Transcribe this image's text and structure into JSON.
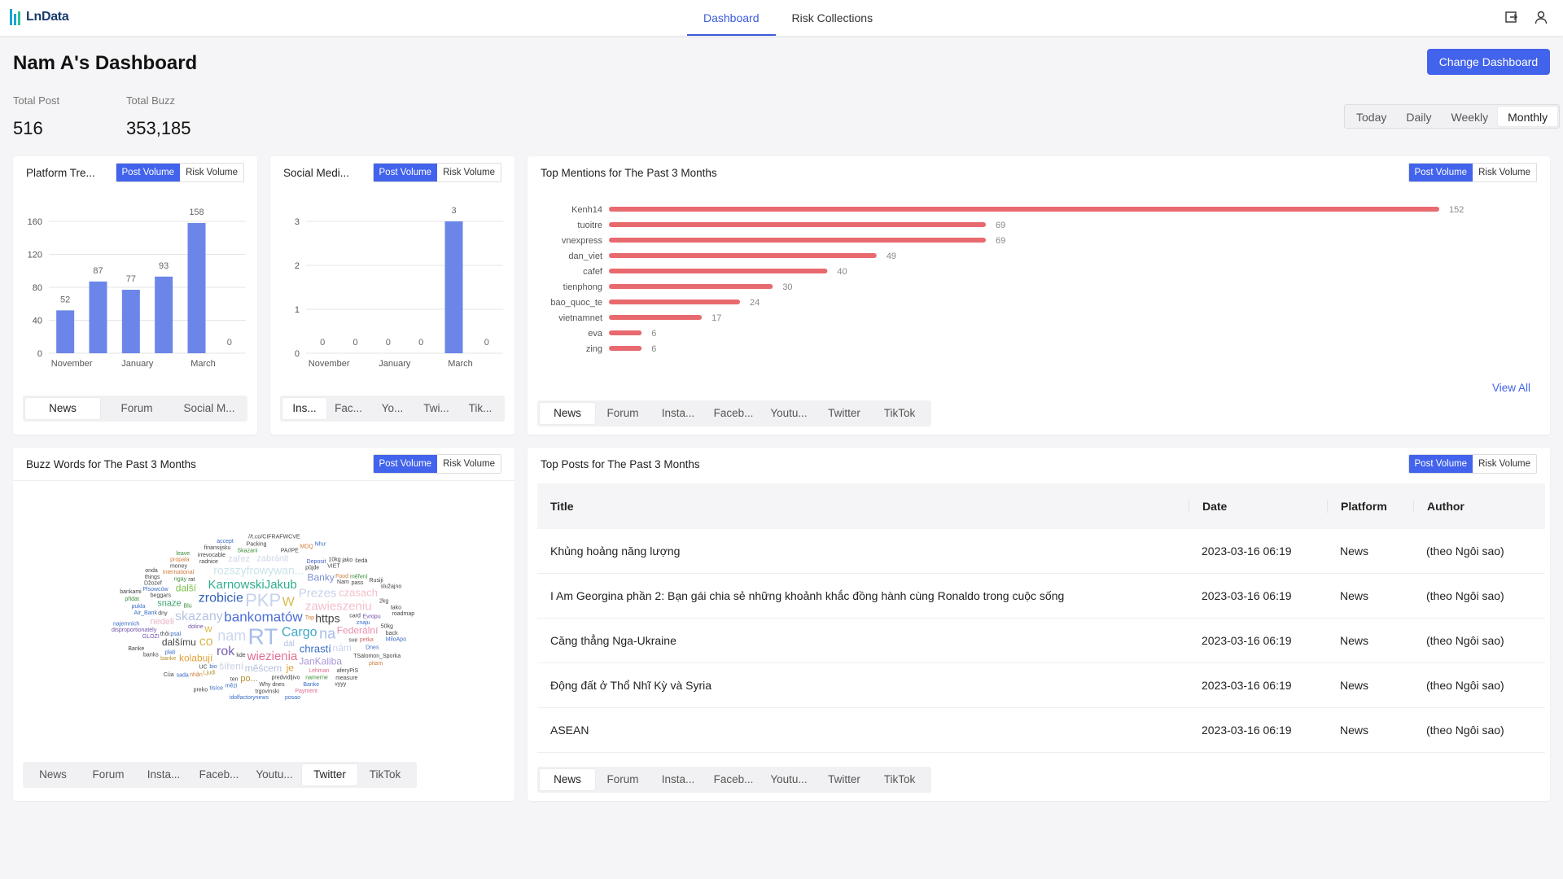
{
  "app": {
    "logo_text": "LnData"
  },
  "nav": {
    "tabs": [
      "Dashboard",
      "Risk Collections"
    ],
    "active": 0
  },
  "page": {
    "title": "Nam A's Dashboard",
    "change_button": "Change Dashboard"
  },
  "stats": {
    "total_post_label": "Total Post",
    "total_post_value": "516",
    "total_buzz_label": "Total Buzz",
    "total_buzz_value": "353,185"
  },
  "period": {
    "options": [
      "Today",
      "Daily",
      "Weekly",
      "Monthly"
    ],
    "active": 3
  },
  "toggle": {
    "post_volume": "Post Volume",
    "risk_volume": "Risk Volume"
  },
  "colors": {
    "accent": "#4263eb",
    "bar": "#6b86e8",
    "mention_bar": "#e86a6f"
  },
  "platform_trend": {
    "title": "Platform Tre...",
    "tabs": [
      "News",
      "Forum",
      "Social M..."
    ],
    "active_tab": 0
  },
  "social_media": {
    "title": "Social Medi...",
    "tabs": [
      "Ins...",
      "Fac...",
      "Yo...",
      "Twi...",
      "Tik..."
    ],
    "active_tab": 0
  },
  "top_mentions": {
    "title": "Top Mentions for The Past 3 Months",
    "view_all": "View All",
    "tabs": [
      "News",
      "Forum",
      "Insta...",
      "Faceb...",
      "Youtu...",
      "Twitter",
      "TikTok"
    ],
    "active_tab": 0
  },
  "buzz_words": {
    "title": "Buzz Words for The Past 3 Months",
    "tabs": [
      "News",
      "Forum",
      "Insta...",
      "Faceb...",
      "Youtu...",
      "Twitter",
      "TikTok"
    ],
    "active_tab": 5,
    "words": [
      {
        "t": "bankomatów",
        "s": 17,
        "c": "#4c6fd6"
      },
      {
        "t": "RT",
        "s": 28,
        "c": "#a7bde8"
      },
      {
        "t": "PKP",
        "s": 22,
        "c": "#c6d2ee"
      },
      {
        "t": "nam",
        "s": 18,
        "c": "#c9d7f0"
      },
      {
        "t": "Cargo",
        "s": 16,
        "c": "#3fa7c7"
      },
      {
        "t": "zrobicie",
        "s": 16,
        "c": "#2f5fb8"
      },
      {
        "t": "KarnowskiJakub",
        "s": 15,
        "c": "#2fae8c"
      },
      {
        "t": "wiezienia",
        "s": 15,
        "c": "#e36f91"
      },
      {
        "t": "skazany",
        "s": 16,
        "c": "#b7c3e2"
      },
      {
        "t": "zawieszeniu",
        "s": 15,
        "c": "#f3c0cc"
      },
      {
        "t": "Prezes",
        "s": 15,
        "c": "#c8d1ea"
      },
      {
        "t": "rozszyfrowywan...",
        "s": 14,
        "c": "#c9e3ea"
      },
      {
        "t": "rok",
        "s": 16,
        "c": "#7c5fb5"
      },
      {
        "t": "https",
        "s": 14,
        "c": "#444"
      },
      {
        "t": "na",
        "s": 18,
        "c": "#a8bde8"
      },
      {
        "t": "W",
        "s": 16,
        "c": "#d9b94e"
      },
      {
        "t": "co",
        "s": 16,
        "c": "#d9b94e"
      },
      {
        "t": "w",
        "s": 13,
        "c": "#d9b94e"
      },
      {
        "t": "chrastí",
        "s": 13,
        "c": "#3a6cc6"
      },
      {
        "t": "mĕšcem",
        "s": 12,
        "c": "#b4c0dd"
      },
      {
        "t": "Banky",
        "s": 12,
        "c": "#7c90d0"
      },
      {
        "t": "šíření",
        "s": 12,
        "c": "#c9cfe2"
      },
      {
        "t": "JanKaliba",
        "s": 12,
        "c": "#ab96d6"
      },
      {
        "t": "Federální",
        "s": 12,
        "c": "#ea8fb0"
      },
      {
        "t": "dalšímu",
        "s": 12,
        "c": "#444"
      },
      {
        "t": "kolabují",
        "s": 12,
        "c": "#e0a23b"
      },
      {
        "t": "další",
        "s": 12,
        "c": "#7ac24c"
      },
      {
        "t": "snaze",
        "s": 11,
        "c": "#3aa16d"
      },
      {
        "t": "zabránit",
        "s": 11,
        "c": "#cfd7e8"
      },
      {
        "t": "czasach",
        "s": 13,
        "c": "#f3c0c8"
      },
      {
        "t": "nám",
        "s": 12,
        "c": "#c8d4ee"
      },
      {
        "t": "nedeli",
        "s": 11,
        "c": "#e9b5c6"
      },
      {
        "t": "zařez",
        "s": 11,
        "c": "#cfd7e8"
      },
      {
        "t": "dál",
        "s": 10,
        "c": "#b2bfe0"
      },
      {
        "t": "je",
        "s": 12,
        "c": "#e0a23b"
      },
      {
        "t": "po...",
        "s": 11,
        "c": "#b38f2c"
      },
      {
        "t": "predvidljivo",
        "s": 7,
        "c": "#444"
      },
      {
        "t": "doline",
        "s": 7,
        "c": "#7050a8"
      },
      {
        "t": "ngay",
        "s": 7,
        "c": "#3a8c3a"
      },
      {
        "t": "Lehman",
        "s": 7,
        "c": "#e06a8b"
      },
      {
        "t": "Deposit",
        "s": 7,
        "c": "#4060c0"
      },
      {
        "t": "Food",
        "s": 7,
        "c": "#d07a3a"
      },
      {
        "t": "Evropu",
        "s": 7,
        "c": "#7050a8"
      },
      {
        "t": "Ljudi",
        "s": 7,
        "c": "#b38f2c"
      },
      {
        "t": "beggars",
        "s": 7,
        "c": "#444"
      },
      {
        "t": "radnice",
        "s": 7,
        "c": "#444"
      },
      {
        "t": "petka",
        "s": 7,
        "c": "#d06a6a"
      },
      {
        "t": "International",
        "s": 7,
        "c": "#d07a3a"
      },
      {
        "t": "Skazani",
        "s": 7,
        "c": "#3a8c3a"
      },
      {
        "t": "namerne",
        "s": 7,
        "c": "#3a8c3a"
      },
      {
        "t": "dnes",
        "s": 7,
        "c": "#444"
      },
      {
        "t": "PA//PE",
        "s": 7,
        "c": "#444"
      },
      {
        "t": "banke",
        "s": 7,
        "c": "#b38f2c"
      },
      {
        "t": "Air_Bank",
        "s": 7,
        "c": "#3a6cc6"
      },
      {
        "t": "Plsowców",
        "s": 7,
        "c": "#3a6cc6"
      },
      {
        "t": "GLOZI",
        "s": 7,
        "c": "#7050a8"
      },
      {
        "t": "irrevocable",
        "s": 7,
        "c": "#444"
      },
      {
        "t": "měření",
        "s": 7,
        "c": "#3a8c3a"
      },
      {
        "t": "Top",
        "s": 7,
        "c": "#d07a3a"
      },
      {
        "t": "nhận",
        "s": 7,
        "c": "#d07a3a"
      },
      {
        "t": "Dnes",
        "s": 7,
        "c": "#3a6cc6"
      },
      {
        "t": "mězi",
        "s": 7,
        "c": "#3a6cc6"
      },
      {
        "t": "money",
        "s": 7,
        "c": "#444"
      },
      {
        "t": "Packing",
        "s": 7,
        "c": "#444"
      },
      {
        "t": "10kg",
        "s": 7,
        "c": "#444"
      },
      {
        "t": "50kg",
        "s": 7,
        "c": "#444"
      },
      {
        "t": "kde",
        "s": 7,
        "c": "#444"
      },
      {
        "t": "2kg",
        "s": 7,
        "c": "#444"
      },
      {
        "t": "aferyPiS",
        "s": 7,
        "c": "#444"
      },
      {
        "t": "Banke",
        "s": 7,
        "c": "#3a6cc6"
      },
      {
        "t": "Džozef",
        "s": 7,
        "c": "#444"
      },
      {
        "t": "trgovinski",
        "s": 7,
        "c": "#444"
      },
      {
        "t": "TSalomon_Sporka",
        "s": 7,
        "c": "#444"
      },
      {
        "t": "pukla",
        "s": 7,
        "c": "#3a6cc6"
      },
      {
        "t": "finansijsku",
        "s": 7,
        "c": "#444"
      },
      {
        "t": "propala",
        "s": 7,
        "c": "#d07a3a"
      },
      {
        "t": "disproportionately",
        "s": 7,
        "c": "#7050a8"
      },
      {
        "t": "sada",
        "s": 7,
        "c": "#3a6cc6"
      },
      {
        "t": "measure",
        "s": 7,
        "c": "#444"
      },
      {
        "t": "Payment",
        "s": 7,
        "c": "#e06a8b"
      },
      {
        "t": "MDQ",
        "s": 7,
        "c": "#d07a3a"
      },
      {
        "t": "banks",
        "s": 7,
        "c": "#444"
      },
      {
        "t": "pûjde",
        "s": 7,
        "c": "#444"
      },
      {
        "t": "card",
        "s": 7,
        "c": "#444"
      },
      {
        "t": "Blu",
        "s": 7,
        "c": "#3a8c3a"
      },
      {
        "t": "bio",
        "s": 7,
        "c": "#3a6cc6"
      },
      {
        "t": "Rusiji",
        "s": 7,
        "c": "#444"
      },
      {
        "t": "jako",
        "s": 7,
        "c": "#444"
      },
      {
        "t": "tisíce",
        "s": 7,
        "c": "#3a6cc6"
      },
      {
        "t": "things",
        "s": 7,
        "c": "#444"
      },
      {
        "t": "back",
        "s": 7,
        "c": "#444"
      },
      {
        "t": "tako",
        "s": 7,
        "c": "#444"
      },
      {
        "t": "přidat",
        "s": 7,
        "c": "#3a8c3a"
      },
      {
        "t": "leave",
        "s": 7,
        "c": "#3a8c3a"
      },
      {
        "t": "accept",
        "s": 7,
        "c": "#3a6cc6"
      },
      {
        "t": "ten",
        "s": 7,
        "c": "#444"
      },
      {
        "t": "//t.co/CIFRAFWCVE",
        "s": 7,
        "c": "#444"
      },
      {
        "t": "Của",
        "s": 7,
        "c": "#444"
      },
      {
        "t": "Như",
        "s": 7,
        "c": "#3a6cc6"
      },
      {
        "t": "thôi",
        "s": 7,
        "c": "#444"
      },
      {
        "t": "pitam",
        "s": 7,
        "c": "#d07a3a"
      },
      {
        "t": "rat",
        "s": 7,
        "c": "#444"
      },
      {
        "t": "najemních",
        "s": 7,
        "c": "#3a6cc6"
      },
      {
        "t": "Nam",
        "s": 7,
        "c": "#444"
      },
      {
        "t": "onda",
        "s": 7,
        "c": "#444"
      },
      {
        "t": "dny",
        "s": 7,
        "c": "#444"
      },
      {
        "t": "MiloApo",
        "s": 7,
        "c": "#3a6cc6"
      },
      {
        "t": "šedá",
        "s": 7,
        "c": "#444"
      },
      {
        "t": "vyyy",
        "s": 7,
        "c": "#444"
      },
      {
        "t": "idolfactorynews",
        "s": 7,
        "c": "#3a6cc6"
      },
      {
        "t": "sve",
        "s": 7,
        "c": "#444"
      },
      {
        "t": "plati",
        "s": 7,
        "c": "#3a6cc6"
      },
      {
        "t": "psal",
        "s": 7,
        "c": "#3a6cc6"
      },
      {
        "t": "UC",
        "s": 7,
        "c": "#444"
      },
      {
        "t": "pass",
        "s": 7,
        "c": "#444"
      },
      {
        "t": "Why",
        "s": 7,
        "c": "#444"
      },
      {
        "t": "preko",
        "s": 7,
        "c": "#444"
      },
      {
        "t": "roadmap",
        "s": 7,
        "c": "#444"
      },
      {
        "t": "Banke",
        "s": 7,
        "c": "#444"
      },
      {
        "t": "VIET",
        "s": 7,
        "c": "#444"
      },
      {
        "t": "znaju",
        "s": 7,
        "c": "#3a6cc6"
      },
      {
        "t": "posao",
        "s": 7,
        "c": "#3a6cc6"
      },
      {
        "t": "služajno",
        "s": 7,
        "c": "#444"
      },
      {
        "t": "bankami",
        "s": 7,
        "c": "#444"
      }
    ]
  },
  "top_posts": {
    "title": "Top Posts for The Past 3 Months",
    "columns": [
      "Title",
      "Date",
      "Platform",
      "Author"
    ],
    "rows": [
      [
        "Khủng hoảng năng lượng",
        "2023-03-16 06:19",
        "News",
        "(theo Ngôi sao)"
      ],
      [
        "I Am Georgina phần 2: Bạn gái chia sẻ những khoảnh khắc đồng hành cùng Ronaldo trong cuộc sống",
        "2023-03-16 06:19",
        "News",
        "(theo Ngôi sao)"
      ],
      [
        "Căng thẳng Nga-Ukraine",
        "2023-03-16 06:19",
        "News",
        "(theo Ngôi sao)"
      ],
      [
        "Động đất ở Thổ Nhĩ Kỳ và Syria",
        "2023-03-16 06:19",
        "News",
        "(theo Ngôi sao)"
      ],
      [
        "ASEAN",
        "2023-03-16 06:19",
        "News",
        "(theo Ngôi sao)"
      ]
    ],
    "tabs": [
      "News",
      "Forum",
      "Insta...",
      "Faceb...",
      "Youtu...",
      "Twitter",
      "TikTok"
    ],
    "active_tab": 0
  },
  "chart_data": [
    {
      "type": "bar",
      "title": "Platform Tre...",
      "categories": [
        "",
        "November",
        "",
        "January",
        "",
        "March",
        ""
      ],
      "values": [
        52,
        87,
        77,
        93,
        158,
        0
      ],
      "tick_labels": [
        "November",
        "January",
        "March"
      ],
      "ylim": [
        0,
        160
      ],
      "yticks": [
        0,
        40,
        80,
        120,
        160
      ],
      "grid": true
    },
    {
      "type": "bar",
      "title": "Social Medi...",
      "values": [
        0,
        0,
        0,
        0,
        3,
        0
      ],
      "tick_labels": [
        "November",
        "January",
        "March"
      ],
      "ylim": [
        0,
        3
      ],
      "yticks": [
        0,
        1,
        2,
        3
      ],
      "grid": true
    },
    {
      "type": "bar",
      "orientation": "horizontal",
      "title": "Top Mentions for The Past 3 Months",
      "categories": [
        "Kenh14",
        "tuoitre",
        "vnexpress",
        "dan_viet",
        "cafef",
        "tienphong",
        "bao_quoc_te",
        "vietnamnet",
        "eva",
        "zing"
      ],
      "values": [
        152,
        69,
        69,
        49,
        40,
        30,
        24,
        17,
        6,
        6
      ],
      "xlim": [
        0,
        152
      ]
    }
  ]
}
